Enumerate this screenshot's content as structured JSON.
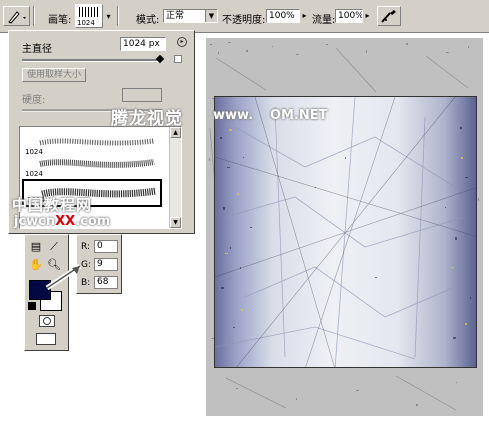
{
  "options_bar": {
    "brush_label": "画笔:",
    "brush_preview_size": "1024",
    "mode_label": "模式:",
    "mode_value": "正常",
    "opacity_label": "不透明度:",
    "opacity_value": "100%",
    "flow_label": "流量:",
    "flow_value": "100%"
  },
  "brush_panel": {
    "master_diameter_label": "主直径",
    "master_diameter_value": "1024 px",
    "sample_size_button": "使用取样大小",
    "hardness_label": "硬度:",
    "brushes": [
      {
        "size": "1024"
      },
      {
        "size": "1024"
      },
      {
        "size": "1024"
      }
    ]
  },
  "color_info": {
    "r_label": "R:",
    "r_value": "0",
    "g_label": "G:",
    "g_value": "9",
    "b_label": "B:",
    "b_value": "68"
  },
  "colors": {
    "foreground": "#000944",
    "background": "#ffffff"
  },
  "watermark": {
    "top": "腾龙视觉",
    "top_url": "www.",
    "top_url_tail": "OM.NET",
    "site_cn": "中国教程网",
    "site_prefix": "jcwcn",
    "site_xx": "XX",
    "site_tail": ".com"
  }
}
